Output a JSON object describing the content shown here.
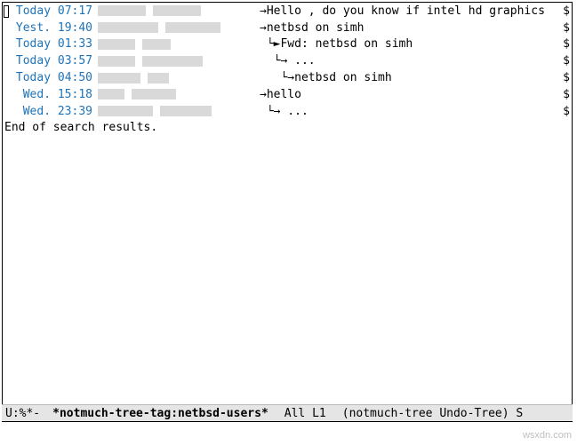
{
  "messages": [
    {
      "time": "Today 07:17",
      "author_w1": 54,
      "author_w2": 54,
      "prefix": "→",
      "subject": "Hello , do you know if intel hd graphics",
      "trunc": "$"
    },
    {
      "time": "Yest. 19:40",
      "author_w1": 68,
      "author_w2": 62,
      "prefix": "→",
      "subject": "netbsd on simh",
      "trunc": "$"
    },
    {
      "time": "Today 01:33",
      "author_w1": 42,
      "author_w2": 32,
      "prefix": " └►",
      "subject": "Fwd: netbsd on simh",
      "trunc": "$"
    },
    {
      "time": "Today 03:57",
      "author_w1": 42,
      "author_w2": 68,
      "prefix": "  └→",
      "subject": " ...",
      "trunc": "$"
    },
    {
      "time": "Today 04:50",
      "author_w1": 48,
      "author_w2": 24,
      "prefix": "   └→",
      "subject": "netbsd on simh",
      "trunc": "$"
    },
    {
      "time": "Wed. 15:18",
      "author_w1": 30,
      "author_w2": 50,
      "prefix": "→",
      "subject": "hello",
      "trunc": "$"
    },
    {
      "time": "Wed. 23:39",
      "author_w1": 62,
      "author_w2": 58,
      "prefix": " └→",
      "subject": " ...",
      "trunc": "$"
    }
  ],
  "end_text": "End of search results.",
  "modeline": {
    "status": "U:%*-",
    "buffer": "*notmuch-tree-tag:netbsd-users*",
    "position": "All L1",
    "modes": "(notmuch-tree Undo-Tree) S"
  },
  "watermark": "wsxdn.com"
}
